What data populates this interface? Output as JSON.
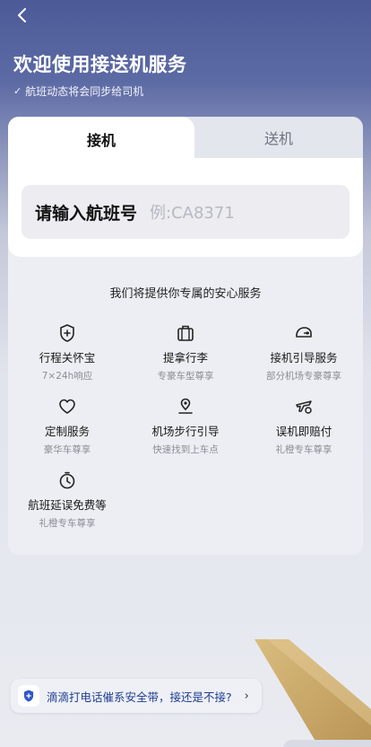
{
  "header": {
    "title": "欢迎使用接送机服务",
    "subtitle": "航班动态将会同步给司机"
  },
  "tabs": {
    "pickup": "接机",
    "dropoff": "送机"
  },
  "flight_input": {
    "label": "请输入航班号",
    "placeholder": "例:CA8371"
  },
  "services": {
    "title": "我们将提供你专属的安心服务",
    "items": [
      {
        "name": "行程关怀宝",
        "desc": "7×24h响应",
        "icon": "shield-plus-icon"
      },
      {
        "name": "提拿行李",
        "desc": "专豪车型尊享",
        "icon": "luggage-icon"
      },
      {
        "name": "接机引导服务",
        "desc": "部分机场专豪尊享",
        "icon": "guide-sign-icon"
      },
      {
        "name": "定制服务",
        "desc": "豪华车尊享",
        "icon": "heart-icon"
      },
      {
        "name": "机场步行引导",
        "desc": "快速找到上车点",
        "icon": "location-pin-icon"
      },
      {
        "name": "误机即赔付",
        "desc": "礼橙专车尊享",
        "icon": "plane-compensation-icon"
      },
      {
        "name": "航班延误免费等",
        "desc": "礼橙专车尊享",
        "icon": "stopwatch-icon"
      }
    ]
  },
  "notice": {
    "text": "滴滴打电话催系安全带，接还是不接?"
  },
  "colors": {
    "header_bg": "#4c5b98",
    "accent_blue": "#2f57c8",
    "tail_gold": "#c9a86a"
  }
}
